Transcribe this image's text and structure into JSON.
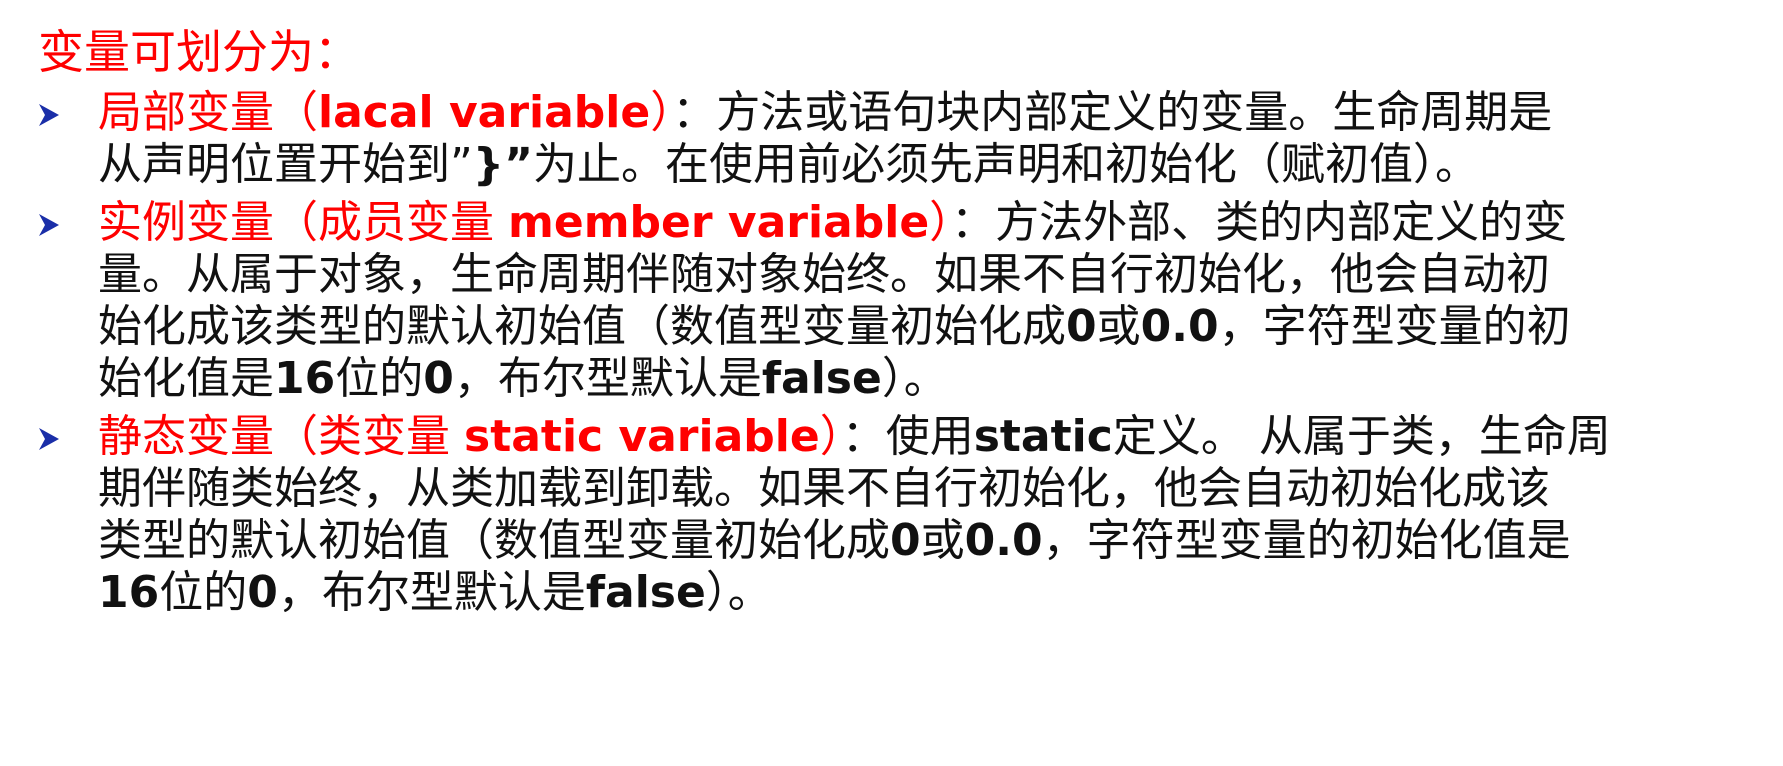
{
  "heading": "变量可划分为：",
  "items": [
    {
      "lines": [
        [
          "局部变量（",
          "lacal  variable",
          "）",
          "：方法或语句块内部定义的变量。生命周期是"
        ],
        [
          "从声明位置开始到”",
          "}”",
          "为止。在使用前必须先声明和初始化（赋初值）。"
        ]
      ]
    },
    {
      "lines": [
        [
          "实例变量（成员变量 ",
          "member variable",
          "）",
          "：方法外部、类的内部定义的变"
        ],
        [
          "量。从属于对象，生命周期伴随对象始终。如果不自行初始化，他会自动初"
        ],
        [
          "始化成该类型的默认初始值（数值型变量初始化成",
          "0",
          "或",
          "0.0",
          "，字符型变量的初"
        ],
        [
          "始化值是",
          "16",
          "位的",
          "0",
          "，布尔型默认是",
          "false",
          "）。"
        ]
      ]
    },
    {
      "lines": [
        [
          "静态变量（类变量 ",
          "static variable",
          "）",
          "：使用",
          "static",
          "定义。 从属于类，生命周"
        ],
        [
          "期伴随类始终，从类加载到卸载。如果不自行初始化，他会自动初始化成该"
        ],
        [
          "类型的默认初始值（数值型变量初始化成",
          "0",
          "或",
          "0.0",
          "，字符型变量的初始化值是"
        ],
        [
          "16",
          "位的",
          "0",
          "，布尔型默认是",
          "false",
          "）。"
        ]
      ]
    }
  ],
  "colors": {
    "accent": "#ff0000",
    "text": "#111111",
    "bullet": "#1a2ea8"
  }
}
